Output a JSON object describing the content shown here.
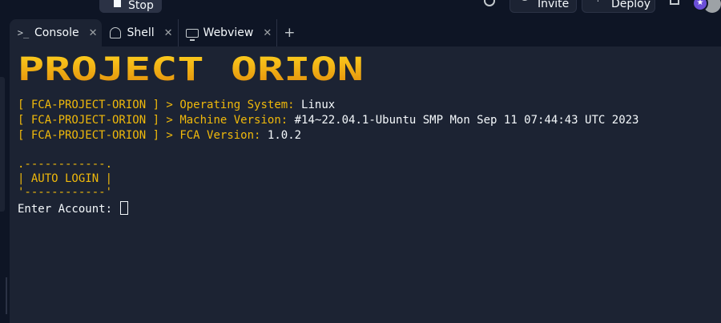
{
  "topbar": {
    "stop_label": "Stop",
    "invite_label": "Invite",
    "deploy_label": "Deploy",
    "avatar_badge": "★"
  },
  "tabs": [
    {
      "label": "Console",
      "icon": "terminal-icon",
      "active": true
    },
    {
      "label": "Shell",
      "icon": "shell-icon",
      "active": false
    },
    {
      "label": "Webview",
      "icon": "monitor-icon",
      "active": false
    }
  ],
  "console": {
    "banner_text": "PROJECT ORION",
    "prefix": "[ FCA-PROJECT-ORION ] >",
    "lines": [
      {
        "key": "Operating System:",
        "value": "Linux"
      },
      {
        "key": "Machine Version:",
        "value": "#14~22.04.1-Ubuntu SMP Mon Sep 11 07:44:43 UTC 2023"
      },
      {
        "key": "FCA Version:",
        "value": "1.0.2"
      }
    ],
    "box_top": ".------------.",
    "box_mid": "| AUTO LOGIN |",
    "box_bottom": "'------------'",
    "prompt": "Enter Account:"
  },
  "colors": {
    "accent_yellow": "#f0b90b",
    "text": "#f5f9fc",
    "background": "#1c2333"
  }
}
